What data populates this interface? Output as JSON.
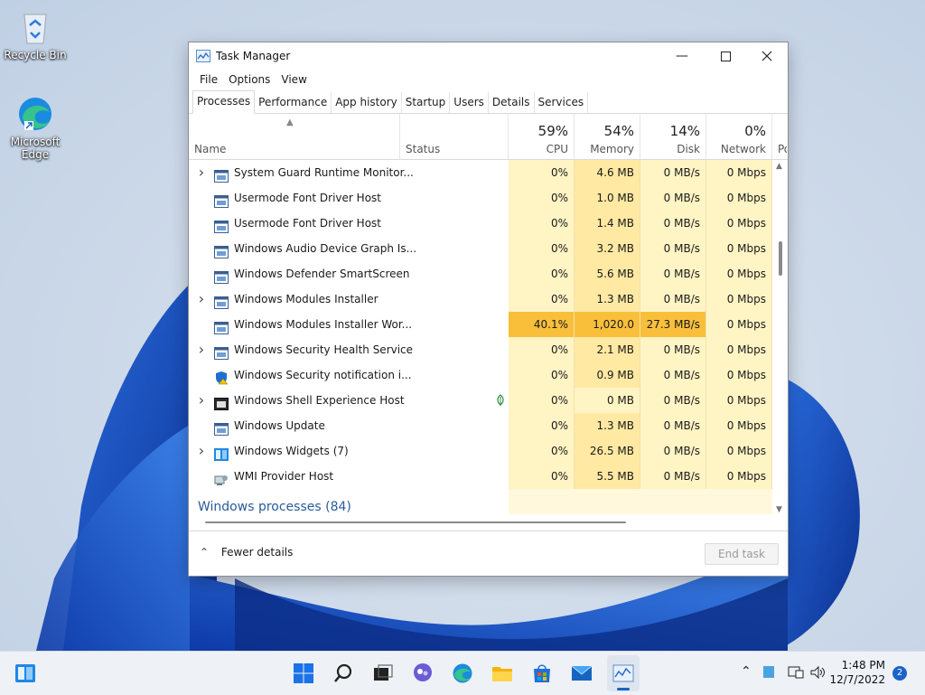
{
  "desktop": {
    "icons": [
      {
        "label": "Recycle Bin",
        "icon": "recycle-bin-icon"
      },
      {
        "label": "Microsoft Edge",
        "icon": "edge-icon"
      }
    ]
  },
  "window": {
    "title": "Task Manager",
    "menu": [
      "File",
      "Options",
      "View"
    ],
    "tabs": [
      "Processes",
      "Performance",
      "App history",
      "Startup",
      "Users",
      "Details",
      "Services"
    ],
    "active_tab": "Processes"
  },
  "columns": {
    "name": {
      "label": "Name"
    },
    "status": {
      "label": "Status"
    },
    "cpu": {
      "label": "CPU",
      "pct": "59%"
    },
    "memory": {
      "label": "Memory",
      "pct": "54%"
    },
    "disk": {
      "label": "Disk",
      "pct": "14%"
    },
    "network": {
      "label": "Network",
      "pct": "0%"
    },
    "power": {
      "label": "Po"
    }
  },
  "processes": [
    {
      "name": "System Guard Runtime Monitor...",
      "expandable": true,
      "icon": "window-app-icon",
      "status": "",
      "cpu": "0%",
      "memory": "4.6 MB",
      "disk": "0 MB/s",
      "network": "0 Mbps"
    },
    {
      "name": "Usermode Font Driver Host",
      "expandable": false,
      "icon": "window-app-icon",
      "status": "",
      "cpu": "0%",
      "memory": "1.0 MB",
      "disk": "0 MB/s",
      "network": "0 Mbps"
    },
    {
      "name": "Usermode Font Driver Host",
      "expandable": false,
      "icon": "window-app-icon",
      "status": "",
      "cpu": "0%",
      "memory": "1.4 MB",
      "disk": "0 MB/s",
      "network": "0 Mbps"
    },
    {
      "name": "Windows Audio Device Graph Is...",
      "expandable": false,
      "icon": "window-app-icon",
      "status": "",
      "cpu": "0%",
      "memory": "3.2 MB",
      "disk": "0 MB/s",
      "network": "0 Mbps"
    },
    {
      "name": "Windows Defender SmartScreen",
      "expandable": false,
      "icon": "window-app-icon",
      "status": "",
      "cpu": "0%",
      "memory": "5.6 MB",
      "disk": "0 MB/s",
      "network": "0 Mbps"
    },
    {
      "name": "Windows Modules Installer",
      "expandable": true,
      "icon": "window-app-icon",
      "status": "",
      "cpu": "0%",
      "memory": "1.3 MB",
      "disk": "0 MB/s",
      "network": "0 Mbps"
    },
    {
      "name": "Windows Modules Installer Wor...",
      "expandable": false,
      "icon": "window-app-icon",
      "status": "",
      "cpu": "40.1%",
      "memory": "1,020.0 MB",
      "disk": "27.3 MB/s",
      "network": "0 Mbps",
      "hot": true
    },
    {
      "name": "Windows Security Health Service",
      "expandable": true,
      "icon": "window-app-icon",
      "status": "",
      "cpu": "0%",
      "memory": "2.1 MB",
      "disk": "0 MB/s",
      "network": "0 Mbps"
    },
    {
      "name": "Windows Security notification i...",
      "expandable": false,
      "icon": "security-shield-icon",
      "status": "",
      "cpu": "0%",
      "memory": "0.9 MB",
      "disk": "0 MB/s",
      "network": "0 Mbps"
    },
    {
      "name": "Windows Shell Experience Host",
      "expandable": true,
      "icon": "dark-window-icon",
      "status": "leaf-icon",
      "cpu": "0%",
      "memory": "0 MB",
      "disk": "0 MB/s",
      "network": "0 Mbps"
    },
    {
      "name": "Windows Update",
      "expandable": false,
      "icon": "window-app-icon",
      "status": "",
      "cpu": "0%",
      "memory": "1.3 MB",
      "disk": "0 MB/s",
      "network": "0 Mbps"
    },
    {
      "name": "Windows Widgets (7)",
      "expandable": true,
      "icon": "widgets-icon",
      "status": "",
      "cpu": "0%",
      "memory": "26.5 MB",
      "disk": "0 MB/s",
      "network": "0 Mbps"
    },
    {
      "name": "WMI Provider Host",
      "expandable": false,
      "icon": "wmi-icon",
      "status": "",
      "cpu": "0%",
      "memory": "5.5 MB",
      "disk": "0 MB/s",
      "network": "0 Mbps"
    }
  ],
  "group": {
    "label": "Windows processes (84)"
  },
  "footer": {
    "fewer_details": "Fewer details",
    "end_task": "End task"
  },
  "taskbar": {
    "icons": [
      "widgets-icon",
      "start-icon",
      "search-icon",
      "task-view-icon",
      "chat-icon",
      "edge-icon",
      "file-explorer-icon",
      "store-icon",
      "mail-icon",
      "task-manager-icon"
    ],
    "time": "1:48 PM",
    "date": "12/7/2022",
    "notifications": "2"
  },
  "colors": {
    "heat_light": "#fff4c4",
    "heat_medium": "#ffe9a3",
    "heat_hot": "#f9bf3b",
    "accent": "#2a5b9c"
  }
}
